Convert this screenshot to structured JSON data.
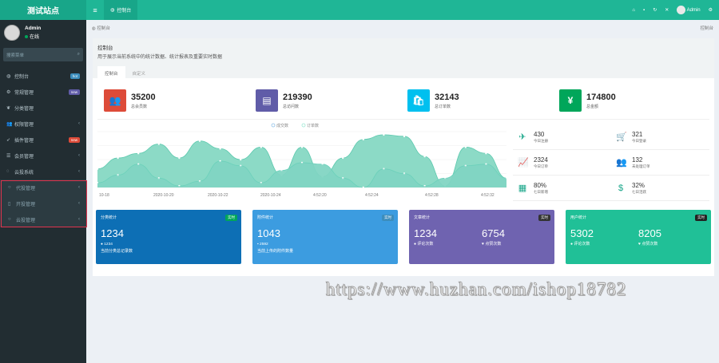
{
  "app": {
    "logo": "测试站点"
  },
  "topbar": {
    "menu_icon": "≡",
    "tab_label": "控制台",
    "user": "Admin"
  },
  "sidebar": {
    "user": {
      "name": "Admin",
      "status": "在线"
    },
    "search_placeholder": "搜索菜单",
    "items": [
      {
        "label": "控制台",
        "icon": "dashboard-icon",
        "badge": "hot",
        "badge_color": "#3c8dbc"
      },
      {
        "label": "常规管理",
        "icon": "cogs-icon",
        "badge": "new",
        "badge_color": "#605ca8"
      },
      {
        "label": "分类管理",
        "icon": "leaf-icon"
      },
      {
        "label": "权限管理",
        "icon": "group-icon"
      },
      {
        "label": "插件管理",
        "icon": "rocket-icon",
        "badge": "new",
        "badge_color": "#dd4b39"
      },
      {
        "label": "会员管理",
        "icon": "list-icon"
      },
      {
        "label": "云投系统",
        "icon": "circle-icon"
      }
    ],
    "subitems": [
      {
        "label": "代投管理"
      },
      {
        "label": "开投管理"
      },
      {
        "label": "云投管理"
      }
    ]
  },
  "breadcrumb": {
    "left": "控制台",
    "right": "控制台"
  },
  "panel": {
    "title": "控制台",
    "description": "用于展示当前系统中的统计数据、统计报表及重要实时数据",
    "tabs": [
      "控制台",
      "自定义"
    ]
  },
  "stats": [
    {
      "value": "35200",
      "label": "总会员数",
      "color": "#dd4b39",
      "icon": "users-icon",
      "glyph": "👥"
    },
    {
      "value": "219390",
      "label": "总访问数",
      "color": "#605ca8",
      "icon": "book-icon",
      "glyph": "▤"
    },
    {
      "value": "32143",
      "label": "总订单数",
      "color": "#00c0ef",
      "icon": "shopping-bag-icon",
      "glyph": "🛍"
    },
    {
      "value": "174800",
      "label": "总金额",
      "color": "#00a65a",
      "icon": "yen-icon",
      "glyph": "¥"
    }
  ],
  "side_stats": [
    {
      "value": "430",
      "label": "今日注册",
      "icon": "rocket-icon",
      "glyph": "✈"
    },
    {
      "value": "321",
      "label": "今日登录",
      "icon": "cart-icon",
      "glyph": "🛒"
    },
    {
      "value": "2324",
      "label": "今日订单",
      "icon": "area-chart-icon",
      "glyph": "📈"
    },
    {
      "value": "132",
      "label": "未处理订单",
      "icon": "users-icon",
      "glyph": "👥"
    },
    {
      "value": "80%",
      "label": "七日新增",
      "icon": "calendar-icon",
      "glyph": "▦"
    },
    {
      "value": "32%",
      "label": "七日活跃",
      "icon": "dollar-icon",
      "glyph": "$"
    }
  ],
  "chart_data": {
    "type": "area",
    "title": "",
    "xlabel": "",
    "ylabel": "",
    "x": [
      "10-18",
      "2020-10-20",
      "2020-10-22",
      "2020-10-24",
      "4:52:20",
      "4:52:24",
      "4:52:28",
      "4:52:32"
    ],
    "legend_position": "top",
    "series": [
      {
        "name": "成交数",
        "color": "#7fd6c0",
        "values": [
          60,
          95,
          110,
          140,
          95,
          150,
          125,
          90,
          130,
          40,
          130,
          35,
          95,
          155,
          170,
          165,
          100,
          5,
          130,
          110,
          30
        ]
      },
      {
        "name": "订单数",
        "color": "#9de8d4",
        "values": [
          15,
          40,
          75,
          30,
          5,
          20,
          85,
          70,
          15,
          55,
          80,
          75,
          30,
          0,
          60,
          45,
          5,
          30,
          70,
          75,
          30
        ]
      }
    ],
    "ylim": [
      0,
      180
    ]
  },
  "cards": [
    {
      "title": "分类统计",
      "badge": "实时",
      "badge_color": "#00a65a",
      "bg": "#0d6fb5",
      "single": true,
      "value": "1234",
      "sub_value": "1234",
      "foot": "当前分类总记录数",
      "sub_icon": "comment-icon"
    },
    {
      "title": "附件统计",
      "badge": "实时",
      "badge_color": "#3c8dbc",
      "bg": "#3c9ce0",
      "single": true,
      "value": "1043",
      "sub_value": "2592",
      "foot": "当前上传的附件数量",
      "sub_icon": "file-icon"
    },
    {
      "title": "文章统计",
      "badge": "实时",
      "badge_color": "#333",
      "bg": "#6f63b0",
      "single": false,
      "value1": "1234",
      "label1": "评论次数",
      "value2": "6754",
      "label2": "点赞次数"
    },
    {
      "title": "用户统计",
      "badge": "实时",
      "badge_color": "#222",
      "bg": "#20c097",
      "single": false,
      "value1": "5302",
      "label1": "评论次数",
      "value2": "8205",
      "label2": "点赞次数"
    }
  ],
  "watermark": "https://www.huzhan.com/ishop18782"
}
